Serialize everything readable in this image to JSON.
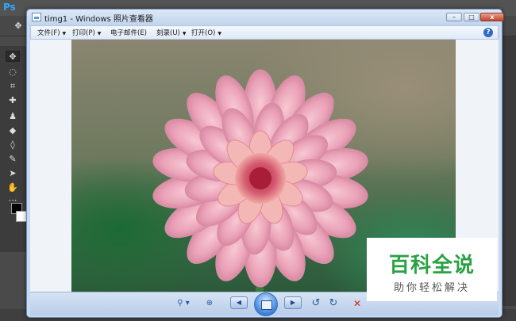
{
  "photoshop": {
    "logo": "Ps"
  },
  "window": {
    "title": "timg1 - Windows 照片查看器",
    "controls": {
      "minimize": "–",
      "maximize": "□",
      "close": "x"
    }
  },
  "menubar": {
    "items": [
      {
        "label": "文件(F)"
      },
      {
        "label": "打印(P)"
      },
      {
        "label": "电子邮件(E)"
      },
      {
        "label": "刻录(U)"
      },
      {
        "label": "打开(O)"
      }
    ],
    "help": "?"
  },
  "controls": {
    "zoom": "⚲",
    "fit": "⊕",
    "prev": "◀",
    "next": "▶",
    "rotate_ccw": "↺",
    "rotate_cw": "↻",
    "delete": "✕"
  },
  "watermark": {
    "title": "百科全说",
    "subtitle": "助你轻松解决"
  },
  "colors": {
    "accent": "#2aa144",
    "window_frame": "#c9daf0"
  }
}
